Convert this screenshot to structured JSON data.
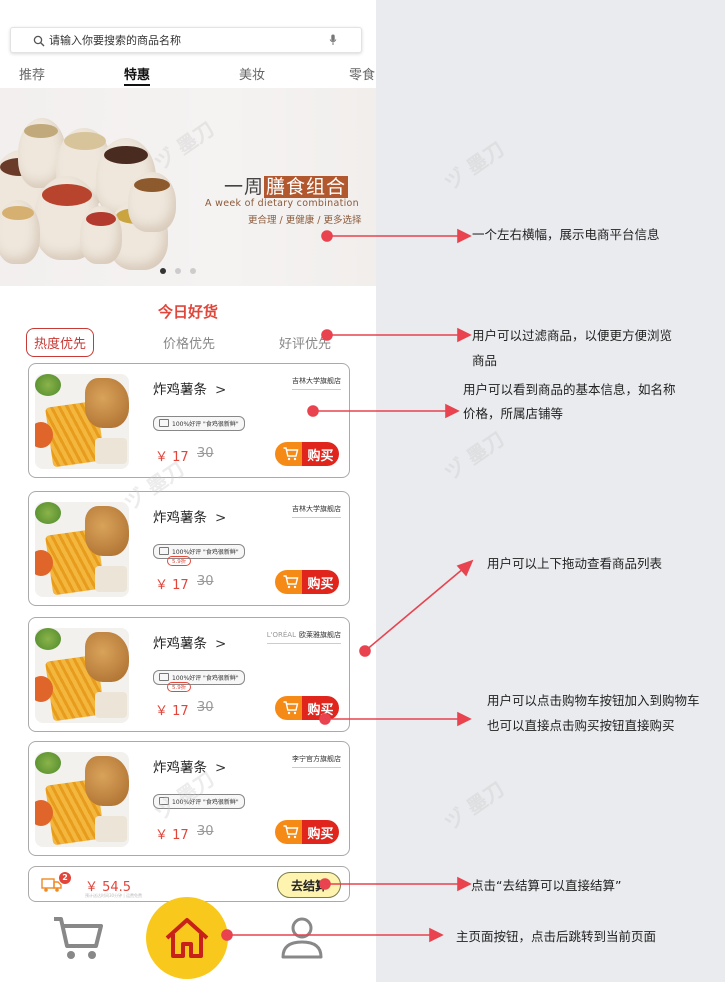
{
  "search": {
    "placeholder": "请输入你要搜索的商品名称"
  },
  "tabs": [
    "推荐",
    "特惠",
    "美妆",
    "零食"
  ],
  "banner": {
    "title_plain": "一周",
    "title_highlight": "膳食组合",
    "subtitle_en": "A week of dietary combination",
    "tagline": "更合理 / 更健康 / 更多选择"
  },
  "section_title": "今日好货",
  "filters": [
    "热度优先",
    "价格优先",
    "好评优先"
  ],
  "products": [
    {
      "name": "炸鸡薯条",
      "arrow": ">",
      "store": "吉林大学旗舰店",
      "badge": "100%好评 \"食鸡很新鲜\"",
      "discount": "",
      "price": "￥ 17",
      "old_price": "30",
      "buy_label": "购买"
    },
    {
      "name": "炸鸡薯条",
      "arrow": ">",
      "store": "吉林大学旗舰店",
      "badge": "100%好评 \"食鸡很新鲜\"",
      "discount": "5.9折",
      "price": "￥ 17",
      "old_price": "30",
      "buy_label": "购买"
    },
    {
      "name": "炸鸡薯条",
      "arrow": ">",
      "store": "欧莱雅旗舰店",
      "store_logo": "L'ORÉAL",
      "badge": "100%好评 \"食鸡很新鲜\"",
      "discount": "5.9折",
      "price": "￥ 17",
      "old_price": "30",
      "buy_label": "购买"
    },
    {
      "name": "炸鸡薯条",
      "arrow": ">",
      "store": "李宁官方旗舰店",
      "badge": "100%好评 \"食鸡很新鲜\"",
      "discount": "",
      "price": "￥ 17",
      "old_price": "30",
      "buy_label": "购买"
    }
  ],
  "checkout": {
    "count": "2",
    "total": "￥ 54.5",
    "note": "预计送达时间30分钟 | 运费免费",
    "button": "去结算"
  },
  "annotations": {
    "banner": "一个左右横幅，展示电商平台信息",
    "filter_1": "用户可以过滤商品，以便更方便浏览",
    "filter_2": "商品",
    "info_1": "用户可以看到商品的基本信息，如名称",
    "info_2": "价格，所属店铺等",
    "scroll": "用户可以上下拖动查看商品列表",
    "cart_1": "用户可以点击购物车按钮加入到购物车",
    "cart_2": "也可以直接点击购买按钮直接购买",
    "checkout": "点击“去结算可以直接结算”",
    "home": "主页面按钮，点击后跳转到当前页面"
  },
  "colors": {
    "accent_red": "#e2453a",
    "arrow_red": "#e8434f",
    "cart_orange": "#f58b16",
    "home_yellow": "#f8c91c"
  },
  "icons": [
    "search-icon",
    "mic-icon",
    "cart-icon",
    "truck-icon",
    "home-icon",
    "user-icon",
    "chevron-right-icon"
  ]
}
